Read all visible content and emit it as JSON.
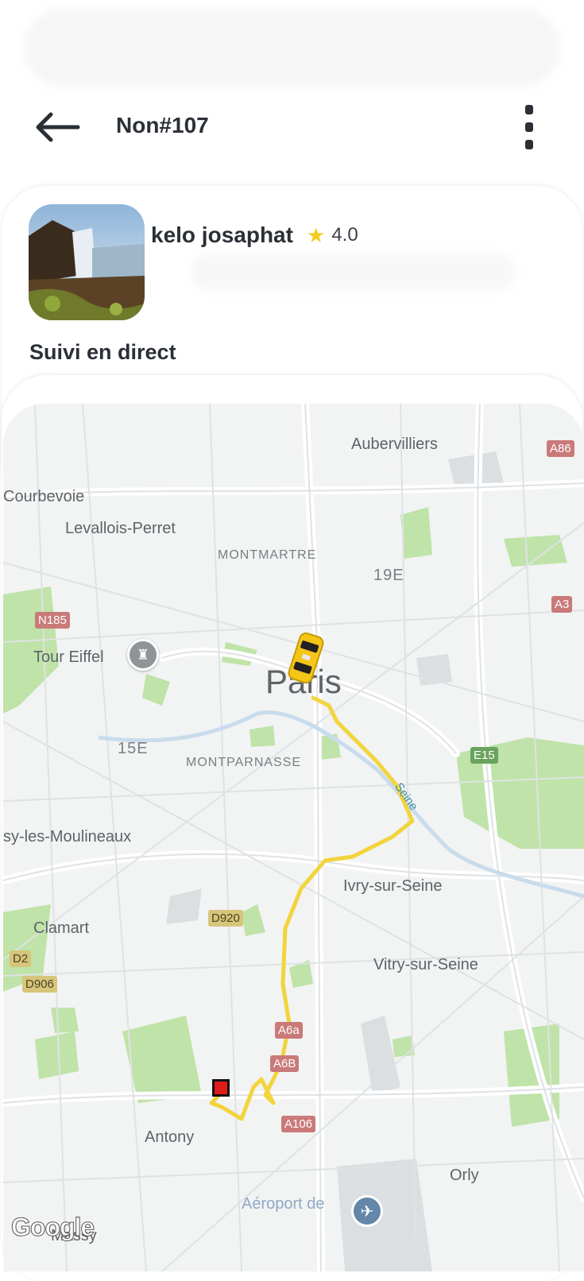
{
  "header": {
    "title": "Non#107",
    "back_icon": "arrow-left-icon",
    "menu_icon": "more-vertical-icon"
  },
  "driver": {
    "name": "kelo josaphat",
    "rating": "4.0",
    "star_icon": "star-icon",
    "star_color": "#f2cc1f"
  },
  "section_title": "Suivi en direct",
  "map": {
    "labels": {
      "aubervilliers": "Aubervilliers",
      "courbevoie": "Courbevoie",
      "levallois": "Levallois-Perret",
      "montmartre": "MONTMARTRE",
      "arr19": "19E",
      "tour_eiffel": "Tour Eiffel",
      "paris": "Paris",
      "arr15": "15E",
      "montparnasse": "MONTPARNASSE",
      "issy": "sy-les-Moulineaux",
      "ivry": "Ivry-sur-Seine",
      "clamart": "Clamart",
      "vitry": "Vitry-sur-Seine",
      "antony": "Antony",
      "orly": "Orly",
      "aeroport": "Aéroport de",
      "massy": "Massy",
      "seine": "Seine"
    },
    "shields": {
      "a86": "A86",
      "a3": "A3",
      "n185": "N185",
      "e15": "E15",
      "d920": "D920",
      "d2": "D2",
      "d906": "D906",
      "a6a": "A6a",
      "a6b": "A6B",
      "a106": "A106"
    },
    "route_color": "#f2d43c",
    "vehicle_icon": "taxi-icon",
    "destination_icon": "destination-marker-icon",
    "attribution": "Google"
  }
}
